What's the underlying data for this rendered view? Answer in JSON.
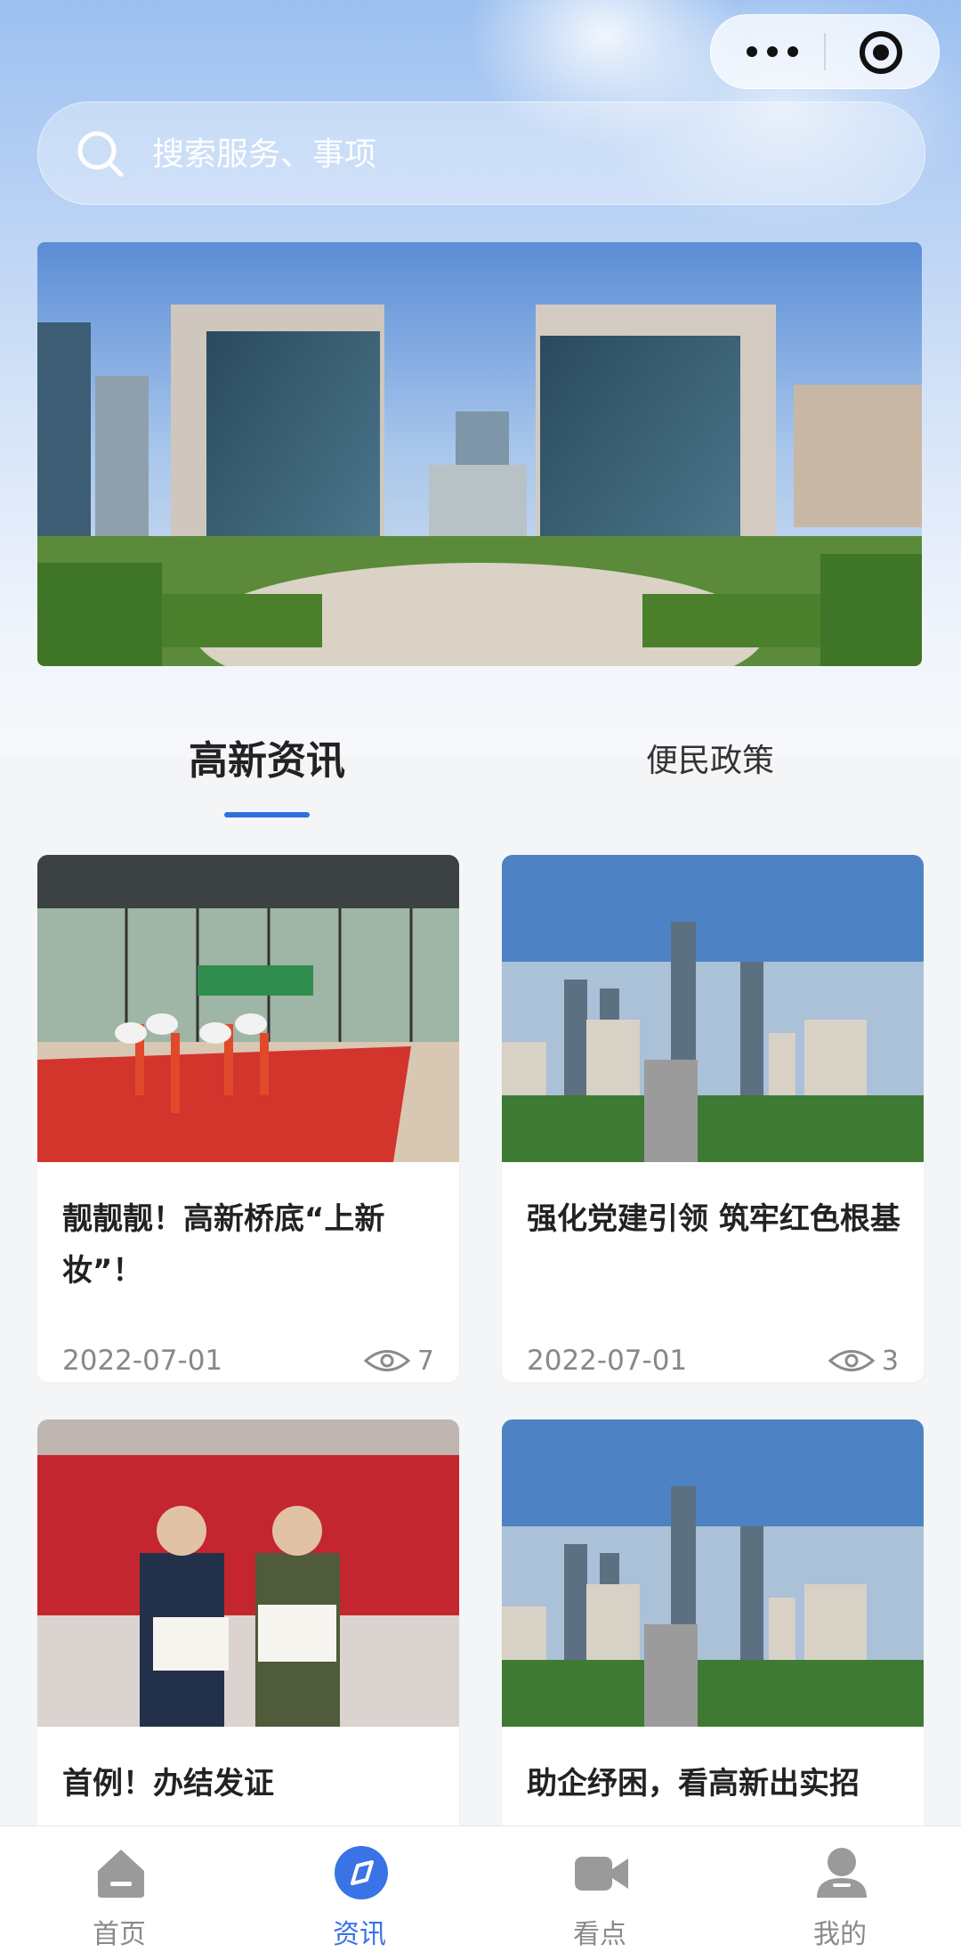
{
  "search": {
    "placeholder": "搜索服务、事项"
  },
  "tabs": [
    {
      "label": "高新资讯",
      "active": true
    },
    {
      "label": "便民政策",
      "active": false
    }
  ],
  "articles": [
    {
      "title": "靓靓靓！高新桥底“上新妆”！",
      "date": "2022-07-01",
      "views": "7"
    },
    {
      "title": "强化党建引领 筑牢红色根基",
      "date": "2022-07-01",
      "views": "3"
    },
    {
      "title": "首例！办结发证",
      "date": "",
      "views": ""
    },
    {
      "title": "助企纾困，看高新出实招",
      "date": "",
      "views": ""
    }
  ],
  "bottom_nav": [
    {
      "label": "首页",
      "icon": "home-icon",
      "active": false
    },
    {
      "label": "资讯",
      "icon": "news-compass-icon",
      "active": true
    },
    {
      "label": "看点",
      "icon": "video-camera-icon",
      "active": false
    },
    {
      "label": "我的",
      "icon": "user-icon",
      "active": false
    }
  ],
  "colors": {
    "accent": "#3a73e6",
    "tab_indicator": "#2f6fe0",
    "inactive": "#8a8a8a"
  }
}
